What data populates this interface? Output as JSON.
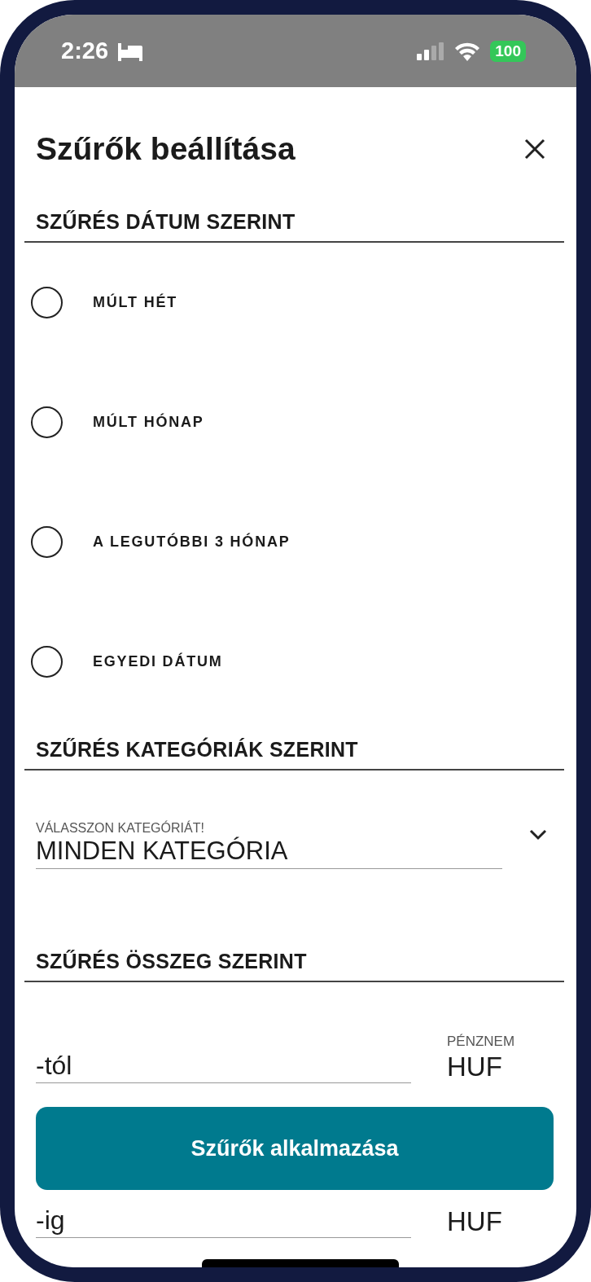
{
  "status_bar": {
    "time": "2:26",
    "battery": "100"
  },
  "title": "Szűrők beállítása",
  "sections": [
    {
      "heading": "SZŰRÉS DÁTUM SZERINT",
      "kind": "radio_group",
      "options": [
        {
          "label": "MÚLT HÉT",
          "selected": false
        },
        {
          "label": "MÚLT HÓNAP",
          "selected": false
        },
        {
          "label": "A LEGUTÓBBI 3 HÓNAP",
          "selected": false
        },
        {
          "label": "EGYEDI DÁTUM",
          "selected": false
        }
      ]
    },
    {
      "heading": "SZŰRÉS KATEGÓRIÁK SZERINT",
      "kind": "dropdown",
      "label": "VÁLASSZON KATEGÓRIÁT!",
      "value": "MINDEN KATEGÓRIA"
    },
    {
      "heading": "SZŰRÉS ÖSSZEG SZERINT",
      "kind": "amount",
      "rows": [
        {
          "placeholder": "-tól",
          "currency_label": "PÉNZNEM",
          "currency": "HUF"
        },
        {
          "placeholder": "-ig",
          "currency": "HUF"
        }
      ]
    }
  ],
  "apply_button": "Szűrők alkalmazása"
}
